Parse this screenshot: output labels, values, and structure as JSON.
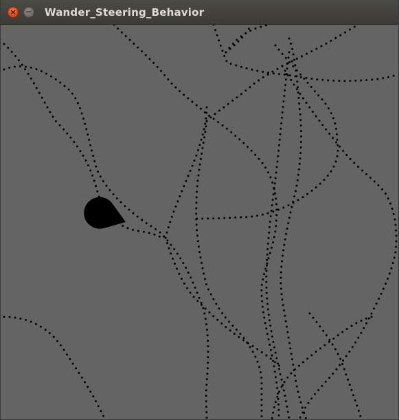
{
  "window": {
    "title": "Wander_Steering_Behavior",
    "close_icon": "×",
    "minimize_icon": "−"
  },
  "canvas": {
    "background": "#646464",
    "trail_color": "#000000",
    "agent_color": "#000000",
    "agent_icon": "teardrop-agent"
  }
}
